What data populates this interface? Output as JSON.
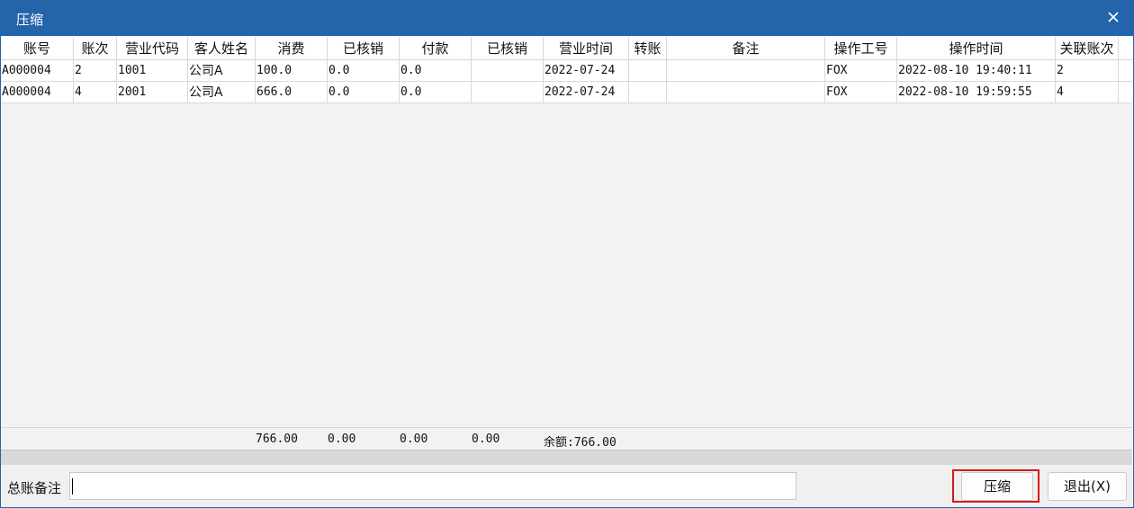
{
  "window": {
    "title": "压缩"
  },
  "table": {
    "columns": [
      "账号",
      "账次",
      "营业代码",
      "客人姓名",
      "消费",
      "已核销",
      "付款",
      "已核销",
      "营业时间",
      "转账",
      "备注",
      "操作工号",
      "操作时间",
      "关联账次"
    ],
    "rows": [
      [
        "A000004",
        "2",
        "1001",
        "公司A",
        "100.0",
        "0.0",
        "0.0",
        "",
        "2022-07-24",
        "",
        "",
        "FOX",
        "2022-08-10 19:40:11",
        "2"
      ],
      [
        "A000004",
        "4",
        "2001",
        "公司A",
        "666.0",
        "0.0",
        "0.0",
        "",
        "2022-07-24",
        "",
        "",
        "FOX",
        "2022-08-10 19:59:55",
        "4"
      ]
    ],
    "totals": {
      "consumption": "766.00",
      "written_off_1": "0.00",
      "payment": "0.00",
      "written_off_2": "0.00",
      "balance": "余额:766.00"
    }
  },
  "footer": {
    "memo_label": "总账备注",
    "memo_value": "",
    "compress_button": "压缩",
    "exit_button": "退出(X)"
  },
  "colors": {
    "titlebar": "#2364ab",
    "highlight": "#d61a1a"
  }
}
